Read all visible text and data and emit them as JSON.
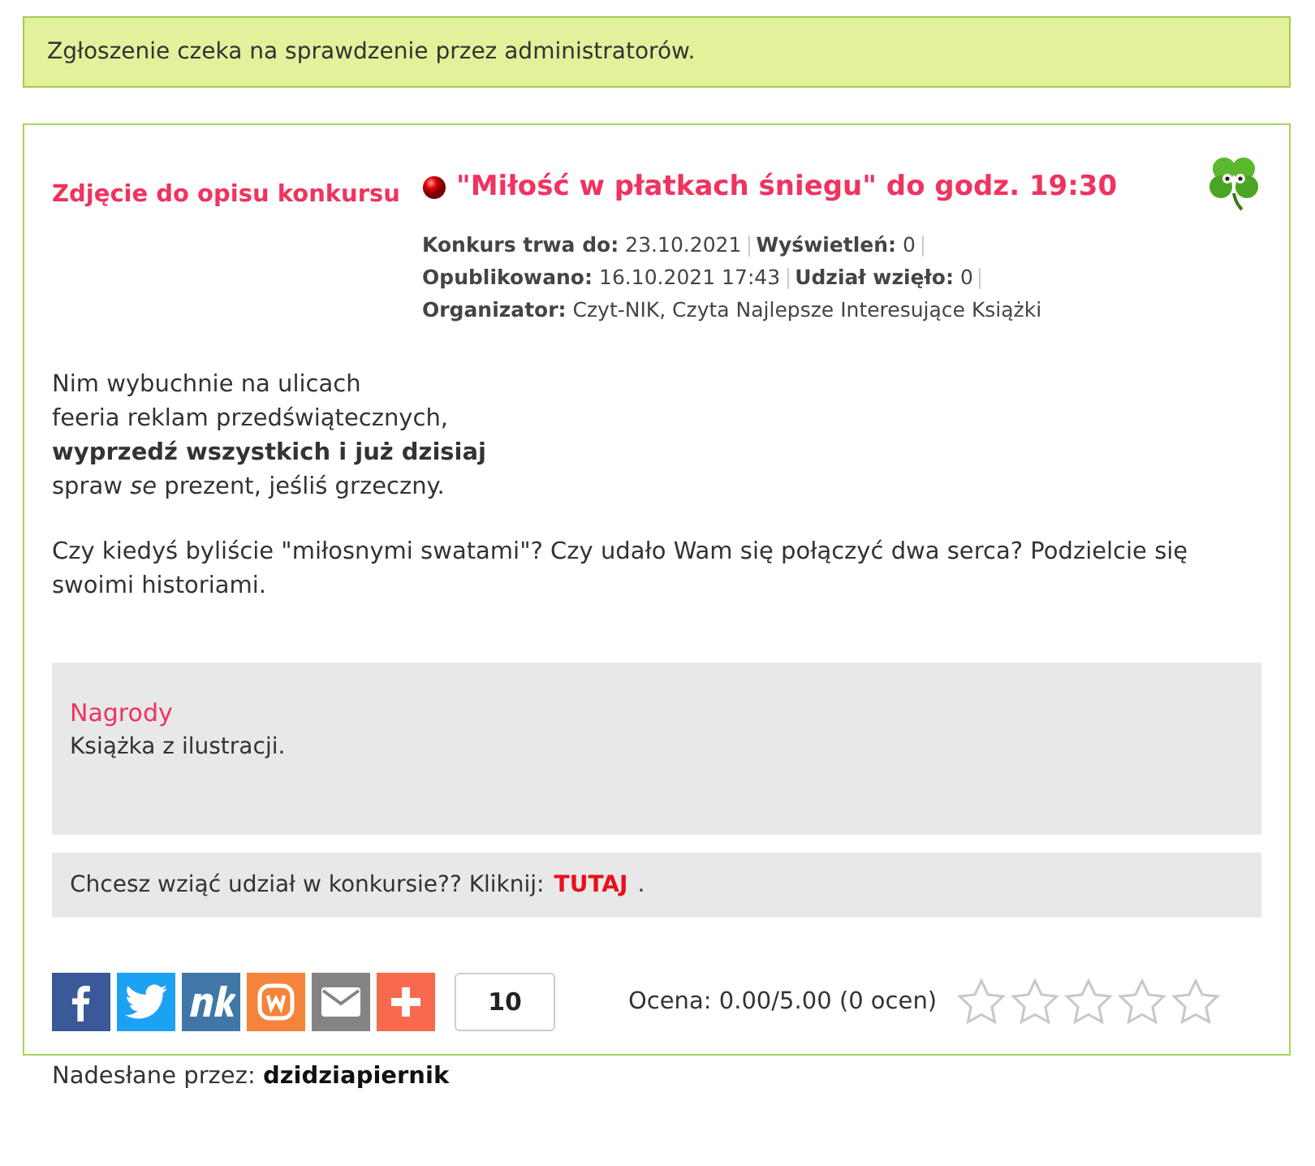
{
  "notice": "Zgłoszenie czeka na sprawdzenie przez administratorów.",
  "photo_label": "Zdjęcie do opisu konkursu",
  "title": "\"Miłość w płatkach śniegu\" do godz. 19:30",
  "meta": [
    [
      {
        "label": "Konkurs trwa do:",
        "value": "23.10.2021"
      },
      {
        "label": "Wyświetleń:",
        "value": "0"
      }
    ],
    [
      {
        "label": "Opublikowano:",
        "value": "16.10.2021 17:43"
      },
      {
        "label": "Udział wzięło:",
        "value": "0"
      }
    ],
    [
      {
        "label": "Organizator:",
        "value": "Czyt-NIK, Czyta Najlepsze Interesujące Książki"
      }
    ]
  ],
  "poem": [
    {
      "kind": "plain",
      "text": "Nim wybuchnie na ulicach"
    },
    {
      "kind": "plain",
      "text": "feeria reklam przedświątecznych,"
    },
    {
      "kind": "bold",
      "text": "wyprzedź wszystkich i już dzisiaj"
    },
    {
      "kind": "plain",
      "text": "spraw *se* prezent, jeśliś grzeczny."
    }
  ],
  "paragraph": "Czy kiedyś byliście \"miłosnymi swatami\"? Czy udało Wam się połączyć dwa serca? Podzielcie się swoimi historiami.",
  "prizes": {
    "heading": "Nagrody",
    "text": "Książka z ilustracji."
  },
  "join": {
    "text": "Chcesz wziąć udział w konkursie?? Kliknij:",
    "link": "TUTAJ",
    "after": "."
  },
  "share": [
    {
      "kind": "facebook"
    },
    {
      "kind": "twitter"
    },
    {
      "kind": "nk"
    },
    {
      "kind": "wykop"
    },
    {
      "kind": "email"
    },
    {
      "kind": "plus"
    }
  ],
  "share_count": "10",
  "rating": {
    "text": "Ocena: 0.00/5.00 (0 ocen)",
    "stars": 0
  },
  "submitted": {
    "label": "Nadesłane przez:",
    "user": "dzidziapiernik"
  }
}
